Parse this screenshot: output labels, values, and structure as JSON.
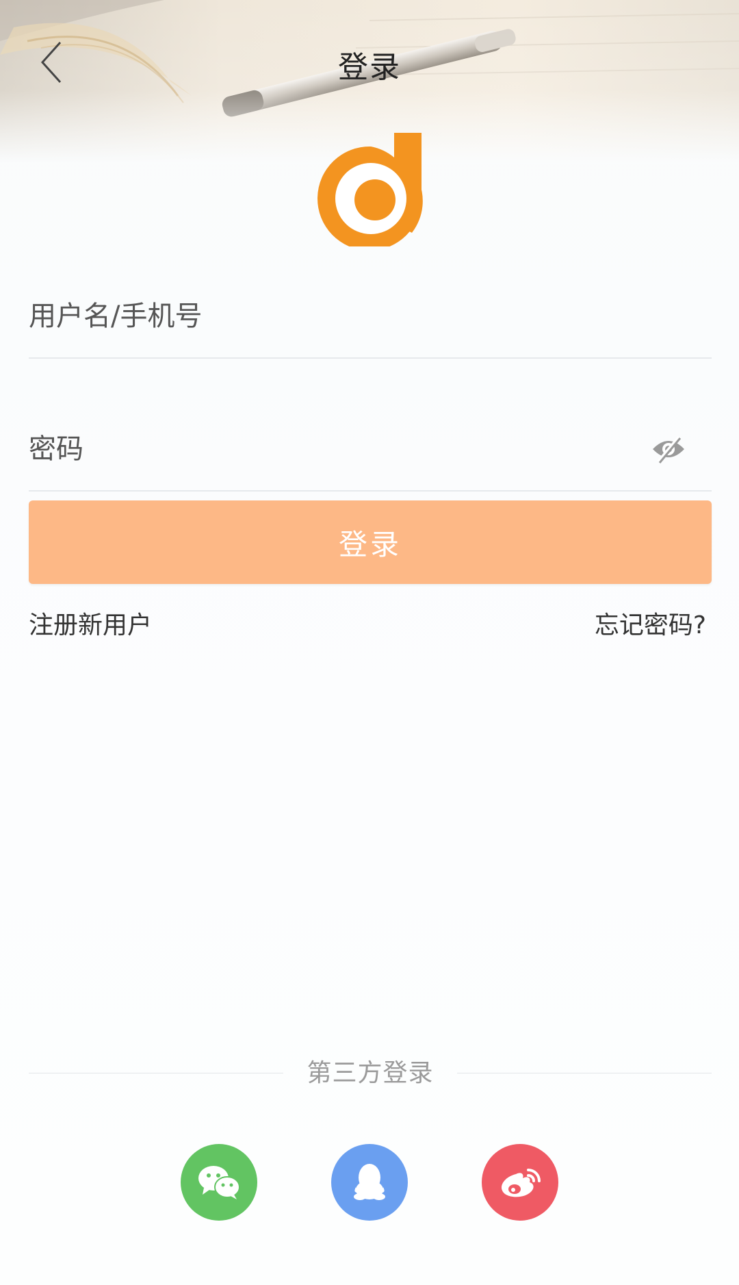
{
  "header": {
    "title": "登录",
    "back_icon": "chevron-left-icon"
  },
  "logo": {
    "icon": "brand-logo-icon",
    "color": "#f39420"
  },
  "form": {
    "username_placeholder": "用户名/手机号",
    "username_value": "",
    "password_placeholder": "密码",
    "password_value": "",
    "eye_icon": "eye-icon",
    "login_label": "登录",
    "login_color": "#fdb886"
  },
  "links": {
    "register": "注册新用户",
    "forgot": "忘记密码?"
  },
  "third_party": {
    "title": "第三方登录",
    "providers": [
      {
        "name": "wechat",
        "icon": "wechat-icon",
        "color": "#62c462"
      },
      {
        "name": "qq",
        "icon": "qq-icon",
        "color": "#6a9ff0"
      },
      {
        "name": "weibo",
        "icon": "weibo-icon",
        "color": "#ef5a64"
      }
    ]
  }
}
